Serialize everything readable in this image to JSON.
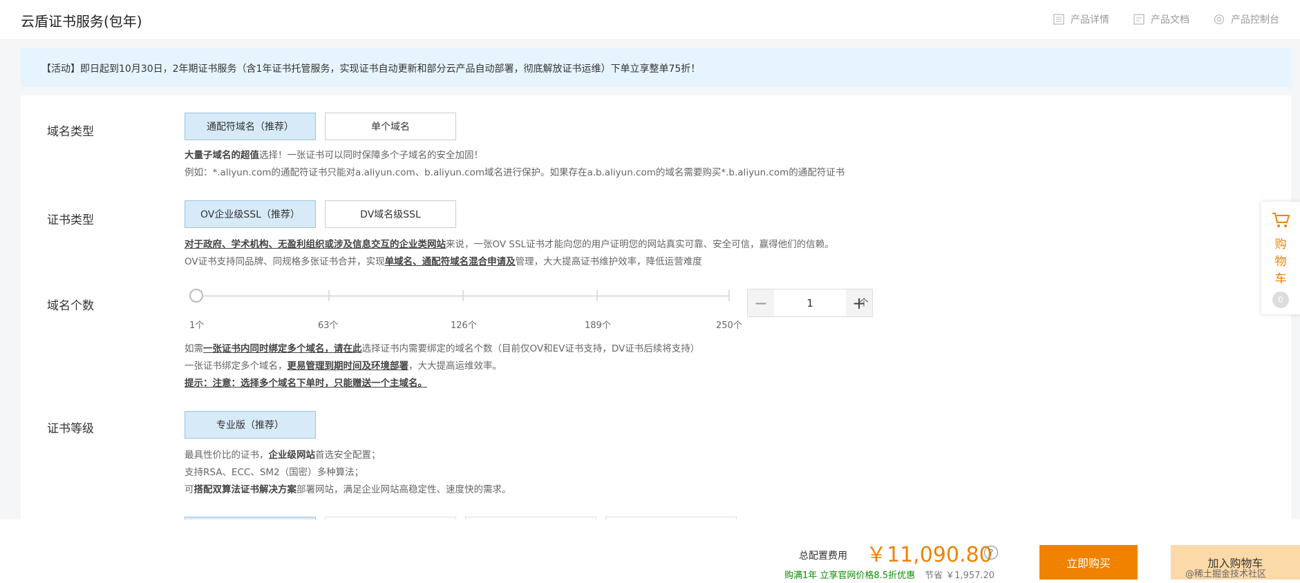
{
  "header": {
    "title": "云盾证书服务(包年)",
    "links": [
      {
        "label": "产品详情",
        "icon": "document-list-icon"
      },
      {
        "label": "产品文档",
        "icon": "document-icon"
      },
      {
        "label": "产品控制台",
        "icon": "gear-icon"
      }
    ]
  },
  "banner": {
    "text": "【活动】即日起到10月30日，2年期证书服务（含1年证书托管服务，实现证书自动更新和部分云产品自动部署，彻底解放证书运维）下单立享整单75折！"
  },
  "sections": {
    "domain_type": {
      "label": "域名类型",
      "options": [
        "通配符域名（推荐）",
        "单个域名"
      ],
      "selected": 0,
      "desc_line1_bold": "大量子域名的超值",
      "desc_line1_rest": "选择！一张证书可以同时保障多个子域名的安全加固！",
      "desc_line2": "例如：*.aliyun.com的通配符证书只能对a.aliyun.com、b.aliyun.com域名进行保护。如果存在a.b.aliyun.com的域名需要购买*.b.aliyun.com的通配符证书"
    },
    "cert_type": {
      "label": "证书类型",
      "options": [
        "OV企业级SSL（推荐）",
        "DV域名级SSL"
      ],
      "selected": 0,
      "desc_line1_bold": "对于政府、学术机构、无盈利组织或涉及信息交互的企业类网站",
      "desc_line1_rest": "来说，一张OV SSL证书才能向您的用户证明您的网站真实可靠、安全可信，赢得他们的信赖。",
      "desc_line2_pre": "OV证书支持同品牌、同规格多张证书合并，实现",
      "desc_line2_bold": "单域名、通配符域名混合申请及",
      "desc_line2_post": "管理，大大提高证书维护效率，降低运营难度"
    },
    "domain_count": {
      "label": "域名个数",
      "slider_value": 1,
      "slider_min": 1,
      "slider_max": 250,
      "tick_labels": [
        "1个",
        "63个",
        "126个",
        "189个",
        "250个"
      ],
      "stepper_value": "1",
      "minus": "−",
      "plus": "+",
      "unit": "个",
      "desc_line1_pre": "如需",
      "desc_line1_bold": "一张证书内同时绑定多个域名，请在此",
      "desc_line1_rest": "选择证书内需要绑定的域名个数（目前仅OV和EV证书支持，DV证书后续将支持）",
      "desc_line2_pre": "一张证书绑定多个域名，",
      "desc_line2_bold": "更易管理到期时间及环境部署",
      "desc_line2_rest": "，大大提高运维效率。",
      "desc_line3": "提示：注意：选择多个域名下单时，只能赠送一个主域名。"
    },
    "cert_level": {
      "label": "证书等级",
      "options": [
        "专业版（推荐）"
      ],
      "selected": 0,
      "desc_line1_pre": "最具性价比的证书，",
      "desc_line1_bold": "企业级网站",
      "desc_line1_rest": "首选安全配置；",
      "desc_line2": "支持RSA、ECC、SM2（国密）多种算法；",
      "desc_line3_pre": "可",
      "desc_line3_bold": "搭配双算法证书解决方案",
      "desc_line3_rest": "部署网站，满足企业网站高稳定性、速度快的需求。"
    }
  },
  "cart": {
    "label": "购物车",
    "count": "0",
    "accent": "#f08200"
  },
  "footer": {
    "total_label": "总配置费用",
    "price": "￥11,090.80",
    "help": "?",
    "promo": "购满1年 立享官网价格8.5折优惠",
    "save_label": "节省",
    "save_amount": "￥1,957.20",
    "buy_label": "立即购买",
    "addcart_label": "加入购物车",
    "watermark": "@稀土掘金技术社区"
  }
}
